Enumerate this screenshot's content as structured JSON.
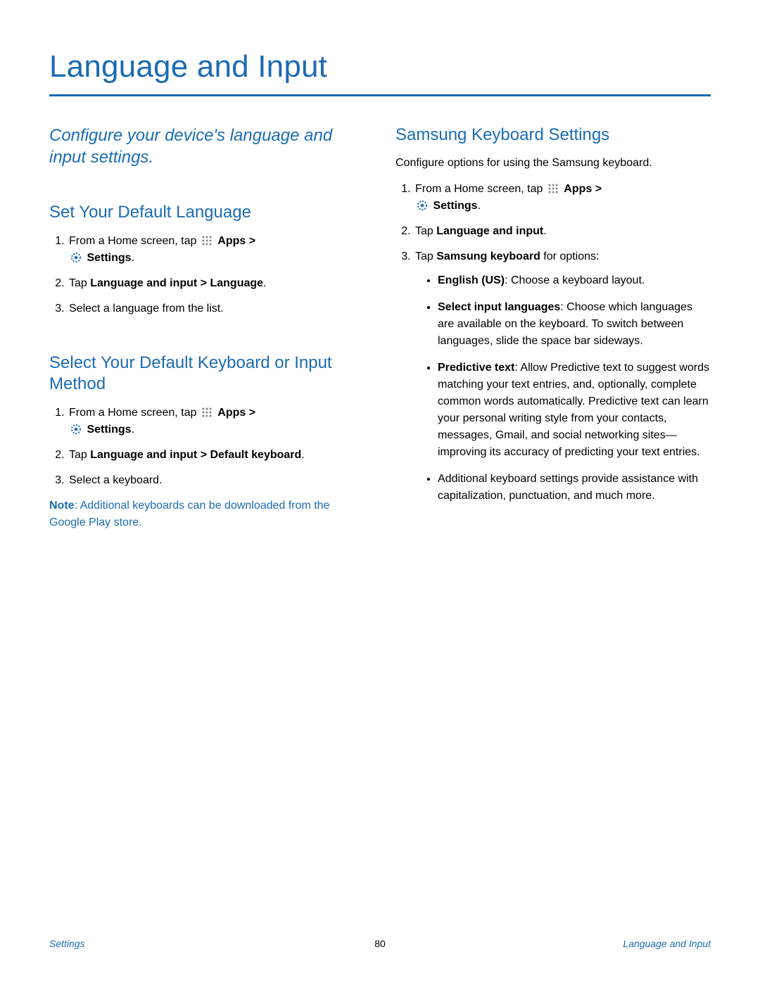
{
  "title": "Language and Input",
  "intro": "Configure your device's language and input settings.",
  "left": {
    "s1": {
      "heading": "Set Your Default Language",
      "step1_a": "From a Home screen, tap ",
      "step1_b": "Apps",
      "step1_c": " > ",
      "step1_d": "Settings",
      "step1_e": ".",
      "step2_a": "Tap ",
      "step2_b": "Language and input > Language",
      "step2_c": ".",
      "step3": "Select a language from the list."
    },
    "s2": {
      "heading": "Select Your Default Keyboard or Input Method",
      "step1_a": "From a Home screen, tap ",
      "step1_b": "Apps",
      "step1_c": " > ",
      "step1_d": "Settings",
      "step1_e": ".",
      "step2_a": "Tap ",
      "step2_b": "Language and input > Default keyboard",
      "step2_c": ".",
      "step3": "Select a keyboard.",
      "note_a": "Note",
      "note_b": ": Additional keyboards can be downloaded from the Google Play store."
    }
  },
  "right": {
    "heading": "Samsung Keyboard Settings",
    "lead": "Configure options for using the Samsung keyboard.",
    "step1_a": "From a Home screen, tap ",
    "step1_b": "Apps",
    "step1_c": " > ",
    "step1_d": "Settings",
    "step1_e": ".",
    "step2_a": "Tap ",
    "step2_b": "Language and input",
    "step2_c": ".",
    "step3_a": "Tap ",
    "step3_b": "Samsung keyboard",
    "step3_c": " for options:",
    "b1_a": "English (US)",
    "b1_b": ": Choose a keyboard layout.",
    "b2_a": "Select input languages",
    "b2_b": ": Choose which languages are available on the keyboard. To switch between languages, slide the space bar sideways.",
    "b3_a": "Predictive text",
    "b3_b": ": Allow Predictive text to suggest words matching your text entries, and, optionally, complete common words automatically. Predictive text can learn your personal writing style from your contacts, messages, Gmail, and social networking sites—improving its accuracy of predicting your text entries.",
    "b4": "Additional keyboard settings provide assistance with capitalization, punctuation, and much more."
  },
  "footer": {
    "left": "Settings",
    "center": "80",
    "right": "Language and Input"
  }
}
